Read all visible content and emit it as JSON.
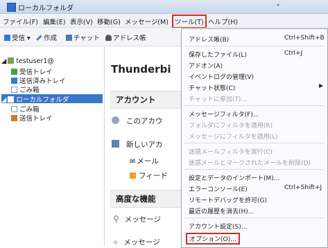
{
  "window": {
    "title": "ローカルフォルダ"
  },
  "menubar": [
    {
      "label": "ファイル(F)",
      "highlighted": false
    },
    {
      "label": "編集(E)",
      "highlighted": false
    },
    {
      "label": "表示(V)",
      "highlighted": false
    },
    {
      "label": "移動(G)",
      "highlighted": false
    },
    {
      "label": "メッセージ(M)",
      "highlighted": false
    },
    {
      "label": "ツール(T)",
      "highlighted": true
    },
    {
      "label": "ヘルプ(H)",
      "highlighted": false
    }
  ],
  "toolbar": {
    "receive": "受信",
    "compose": "作成",
    "chat": "チャット",
    "addressbook": "アドレス帳"
  },
  "folders": {
    "account": "testuser1@",
    "inbox": "受信トレイ",
    "sent": "送信済みトレイ",
    "trash1": "ごみ箱",
    "local": "ローカルフォルダ",
    "trash2": "ごみ箱",
    "outbox": "送信トレイ"
  },
  "main": {
    "title": "Thunderbi",
    "section_account": "アカウント",
    "row_this_account": "このアカウ",
    "row_new_account": "新しいアカ",
    "row_mail": "メール",
    "row_feed": "フィード",
    "section_advanced": "高度な機能",
    "row_msg1": "メッセージ",
    "row_msg2": "メッセージ"
  },
  "tools_menu": [
    {
      "label": "アドレス帳(B)",
      "shortcut": "Ctrl+Shift+B",
      "disabled": false
    },
    {
      "sep": true
    },
    {
      "label": "保存したファイル(L)",
      "shortcut": "Ctrl+J",
      "disabled": false
    },
    {
      "label": "アドオン(A)",
      "shortcut": "",
      "disabled": false
    },
    {
      "label": "イベントログの管理(V)",
      "shortcut": "",
      "disabled": false
    },
    {
      "label": "チャット状態(C)",
      "shortcut": "",
      "disabled": false,
      "submenu": true
    },
    {
      "label": "チャットに参加(T)...",
      "shortcut": "",
      "disabled": true
    },
    {
      "sep": true
    },
    {
      "label": "メッセージフィルタ(F)...",
      "shortcut": "",
      "disabled": false
    },
    {
      "label": "フォルダにフィルタを適用(R)",
      "shortcut": "",
      "disabled": true
    },
    {
      "label": "メッセージにフィルタを適用(L)",
      "shortcut": "",
      "disabled": true
    },
    {
      "sep": true
    },
    {
      "label": "迷惑メールフィルタを実行(C)",
      "shortcut": "",
      "disabled": true
    },
    {
      "label": "迷惑メールとマークされたメールを削除(D)",
      "shortcut": "",
      "disabled": true
    },
    {
      "sep": true
    },
    {
      "label": "設定とデータのインポート(M)...",
      "shortcut": "",
      "disabled": false
    },
    {
      "label": "エラーコンソール(E)",
      "shortcut": "Ctrl+Shift+J",
      "disabled": false
    },
    {
      "label": "リモートデバッグを許可(G)",
      "shortcut": "",
      "disabled": false
    },
    {
      "label": "最近の履歴を消去(H)...",
      "shortcut": "",
      "disabled": false
    },
    {
      "sep": true
    },
    {
      "label": "アカウント設定(S)...",
      "shortcut": "",
      "disabled": false
    },
    {
      "label": "オプション(O)...",
      "shortcut": "",
      "disabled": false,
      "highlighted": true
    }
  ],
  "colors": {
    "highlight_box": "#e0261c",
    "selection": "#3c76c6"
  }
}
